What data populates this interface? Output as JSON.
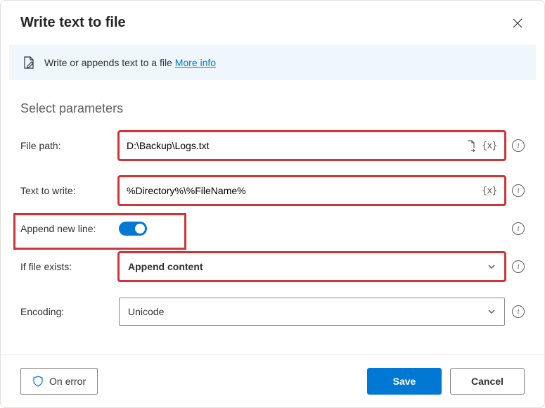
{
  "header": {
    "title": "Write text to file"
  },
  "banner": {
    "text": "Write or appends text to a file ",
    "moreInfo": "More info"
  },
  "sectionTitle": "Select parameters",
  "fields": {
    "filePath": {
      "label": "File path:",
      "value": "D:\\Backup\\Logs.txt"
    },
    "textToWrite": {
      "label": "Text to write:",
      "value": "%Directory%\\%FileName%"
    },
    "appendNewLine": {
      "label": "Append new line:",
      "on": true
    },
    "ifFileExists": {
      "label": "If file exists:",
      "selected": "Append content"
    },
    "encoding": {
      "label": "Encoding:",
      "selected": "Unicode"
    }
  },
  "footer": {
    "onError": "On error",
    "save": "Save",
    "cancel": "Cancel"
  }
}
